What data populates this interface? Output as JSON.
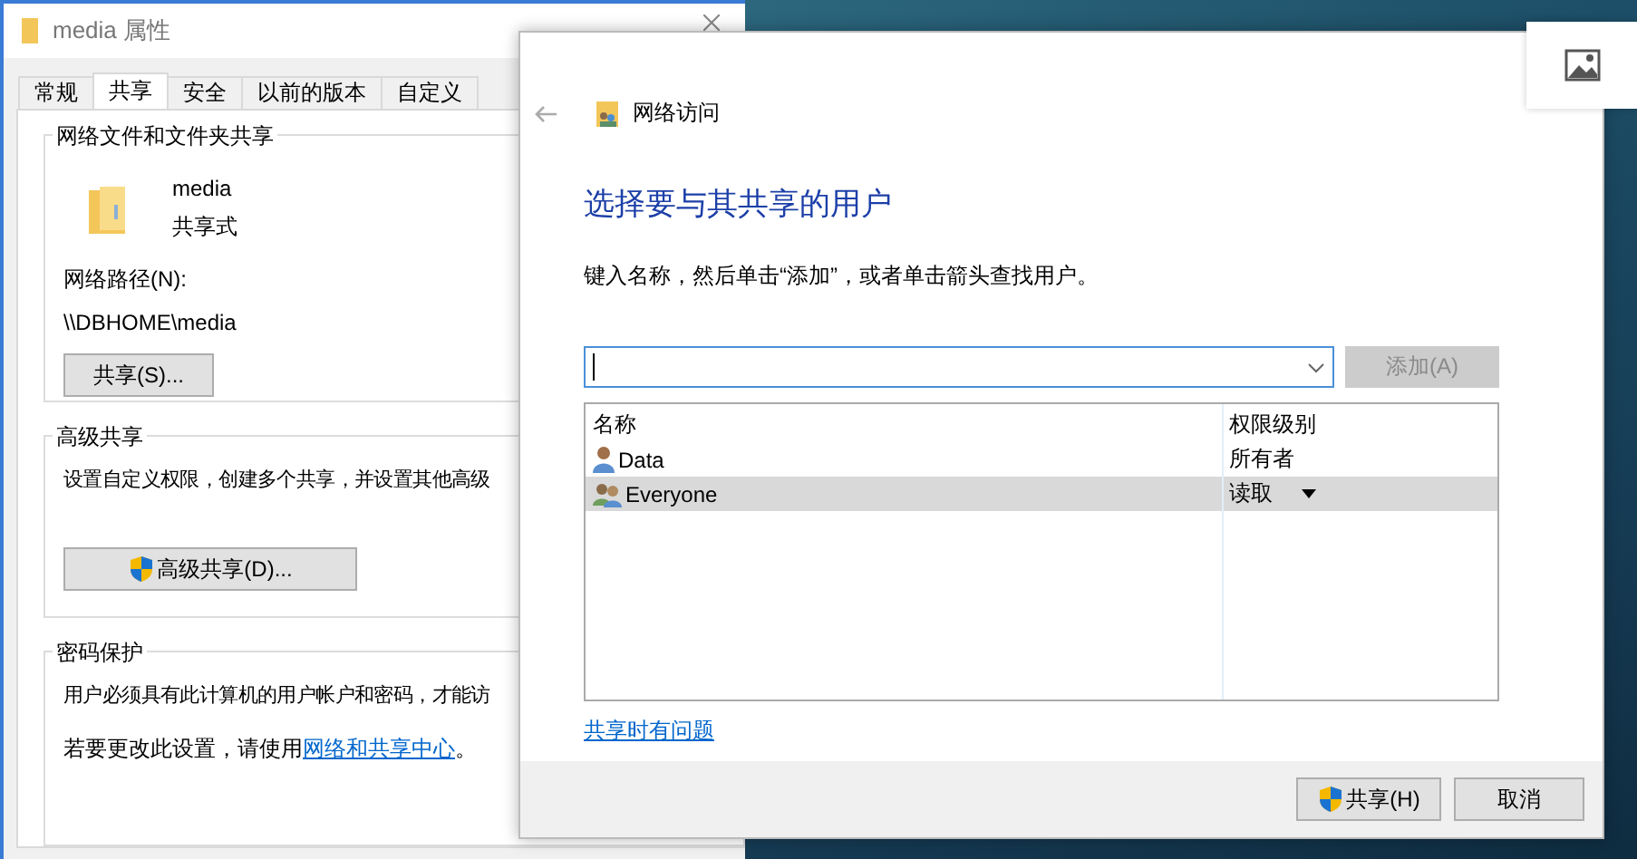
{
  "properties_window": {
    "title": "media 属性",
    "tabs": [
      {
        "label": "常规",
        "selected": false
      },
      {
        "label": "共享",
        "selected": true
      },
      {
        "label": "安全",
        "selected": false
      },
      {
        "label": "以前的版本",
        "selected": false
      },
      {
        "label": "自定义",
        "selected": false
      }
    ],
    "network_sharing": {
      "heading": "网络文件和文件夹共享",
      "folder_name": "media",
      "folder_state": "共享式",
      "path_label": "网络路径(N):",
      "path": "\\\\DBHOME\\media",
      "share_button": "共享(S)..."
    },
    "advanced_sharing": {
      "heading": "高级共享",
      "description": "设置自定义权限，创建多个共享，并设置其他高级",
      "button": "高级共享(D)..."
    },
    "password_protection": {
      "heading": "密码保护",
      "description": "用户必须具有此计算机的用户帐户和密码，才能访",
      "change_text": "若要更改此设置，请使用",
      "link": "网络和共享中心",
      "after_link": "。"
    }
  },
  "share_dialog": {
    "title": "网络访问",
    "heading": "选择要与其共享的用户",
    "instruction": "键入名称，然后单击“添加”，或者单击箭头查找用户。",
    "add_button": {
      "label": "添加(A)",
      "disabled": true
    },
    "columns": [
      "名称",
      "权限级别"
    ],
    "users": [
      {
        "name": "Data",
        "permission": "所有者",
        "kind": "user",
        "selected": false
      },
      {
        "name": "Everyone",
        "permission": "读取",
        "kind": "group",
        "selected": true
      }
    ],
    "help_link": "共享时有问题",
    "share_button": "共享(H)",
    "cancel_button": "取消"
  }
}
